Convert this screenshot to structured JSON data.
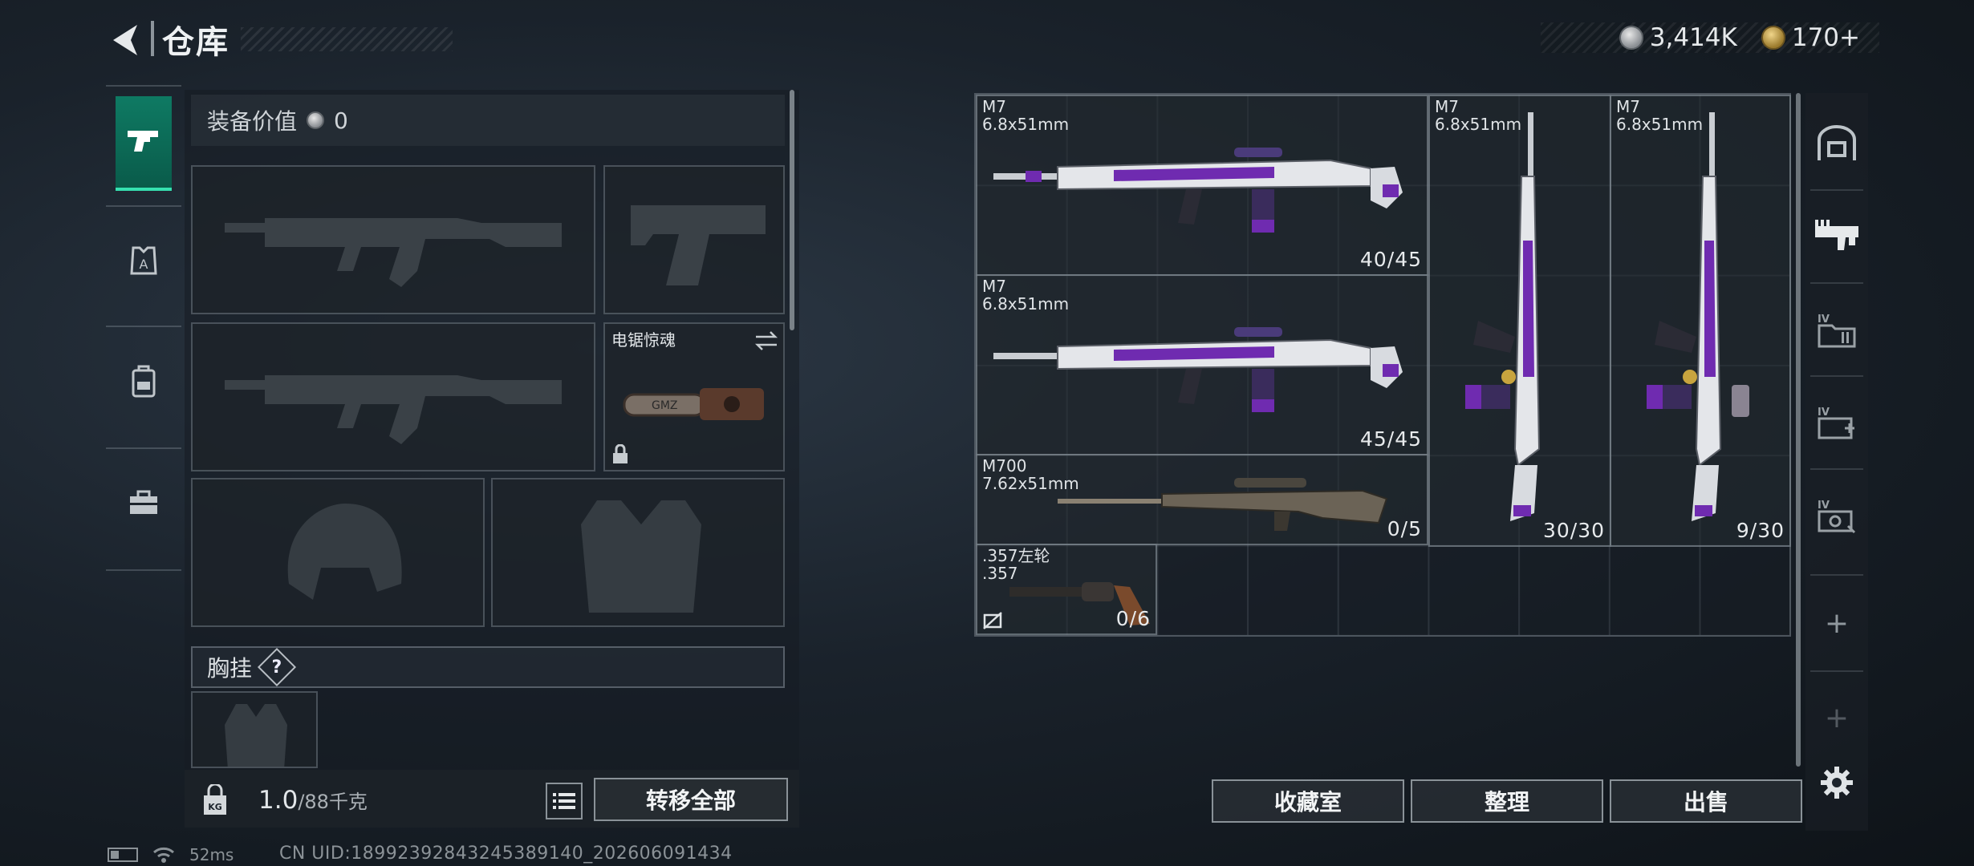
{
  "header": {
    "title": "仓库",
    "back_icon": "back-arrow-icon"
  },
  "currency": {
    "silver": "3,414K",
    "gold": "170+",
    "silver_icon": "silver-coin-icon",
    "gold_icon": "gold-coin-icon"
  },
  "side_nav": {
    "items": [
      {
        "name": "weapons",
        "icon": "pistol-icon",
        "active": true
      },
      {
        "name": "armor",
        "icon": "armor-plate-icon",
        "active": false
      },
      {
        "name": "backpack",
        "icon": "backpack-icon",
        "active": false
      },
      {
        "name": "toolbox",
        "icon": "toolbox-icon",
        "active": false
      }
    ]
  },
  "loadout": {
    "equip_value_label": "装备价值",
    "equip_value": "0",
    "melee_name": "电锯惊魂",
    "chest_label": "胸挂",
    "chest_help": "?",
    "weight_current": "1.0",
    "weight_max": "/88千克",
    "transfer_all": "转移全部"
  },
  "stash": {
    "items": [
      {
        "name": "M7",
        "caliber": "6.8x51mm",
        "ammo": "40/45"
      },
      {
        "name": "M7",
        "caliber": "6.8x51mm",
        "ammo": "45/45"
      },
      {
        "name": "M700",
        "caliber": "7.62x51mm",
        "ammo": "0/5"
      },
      {
        "name": ".357左轮",
        "caliber": ".357",
        "ammo": "0/6"
      },
      {
        "name": "M7",
        "caliber": "6.8x51mm",
        "ammo": "30/30"
      },
      {
        "name": "M7",
        "caliber": "6.8x51mm",
        "ammo": "9/30"
      }
    ],
    "buttons": {
      "collection": "收藏室",
      "organize": "整理",
      "sell": "出售"
    }
  },
  "status_bar": {
    "ping": "52ms",
    "uid": "CN UID:18992392843245389140_202606091434"
  },
  "colors": {
    "accent": "#0e7a63",
    "weapon_purple": "#6f2bb0"
  }
}
